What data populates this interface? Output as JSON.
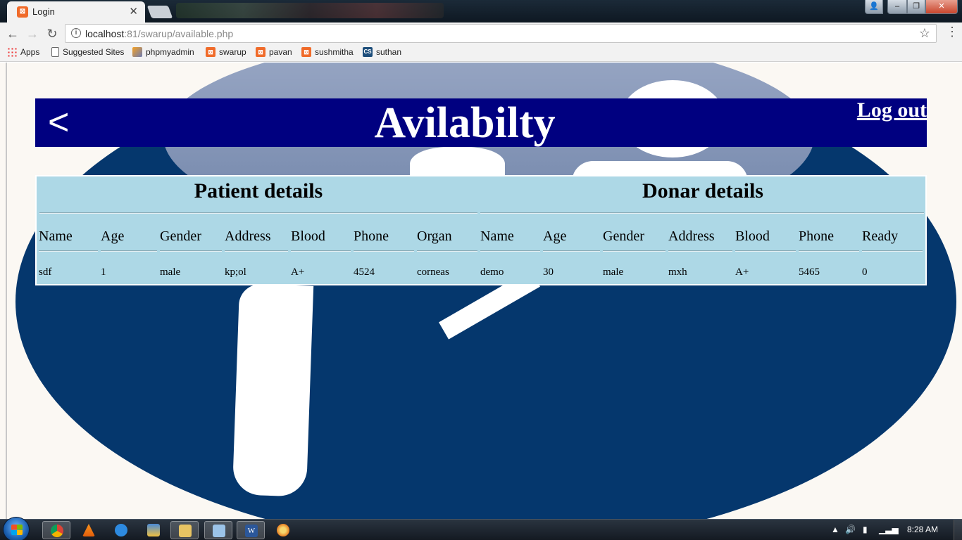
{
  "browser": {
    "tab_title": "Login",
    "tab_close": "✕",
    "url_host": "localhost",
    "url_rest": ":81/swarup/available.php",
    "bookmarks": [
      {
        "label": "Apps",
        "icon": "apps-icon"
      },
      {
        "label": "Suggested Sites",
        "icon": "page-icon"
      },
      {
        "label": "phpmyadmin",
        "icon": "phpmyadmin-icon"
      },
      {
        "label": "swarup",
        "icon": "xampp-icon"
      },
      {
        "label": "pavan",
        "icon": "xampp-icon"
      },
      {
        "label": "sushmitha",
        "icon": "xampp-icon"
      },
      {
        "label": "suthan",
        "icon": "cs-icon"
      }
    ]
  },
  "page": {
    "back": "<",
    "title": "Avilabilty",
    "logout": "Log out",
    "patient_heading": "Patient details",
    "donor_heading": "Donar details",
    "patient_columns": [
      "Name",
      "Age",
      "Gender",
      "Address",
      "Blood",
      "Phone",
      "Organ"
    ],
    "donor_columns": [
      "Name",
      "Age",
      "Gender",
      "Address",
      "Blood",
      "Phone",
      "Ready"
    ],
    "patient_row": [
      "sdf",
      "1",
      "male",
      "kp;ol",
      "A+",
      "4524",
      "corneas"
    ],
    "donor_row": [
      "demo",
      "30",
      "male",
      "mxh",
      "A+",
      "5465",
      "0"
    ]
  },
  "taskbar": {
    "clock": "8:28 AM",
    "apps": [
      "chrome",
      "vlc",
      "app",
      "app",
      "explorer",
      "notepad",
      "word",
      "paint"
    ]
  }
}
